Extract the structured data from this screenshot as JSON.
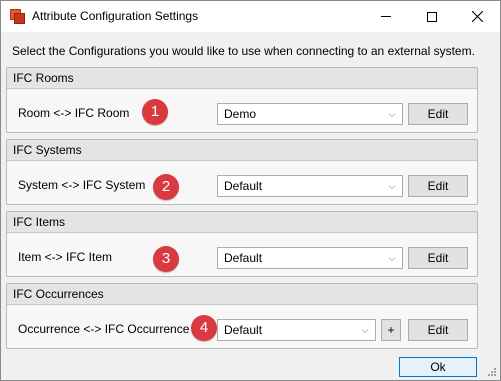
{
  "window": {
    "title": "Attribute Configuration Settings",
    "accent_color": "#d93a3f",
    "app_icon": "app-logo-icon"
  },
  "instruction": "Select the Configurations you would like to use when connecting to an external system.",
  "groups": [
    {
      "header": "IFC Rooms",
      "label": "Room <-> IFC Room",
      "badge": "1",
      "selected": "Demo",
      "edit_label": "Edit"
    },
    {
      "header": "IFC Systems",
      "label": "System <-> IFC System",
      "badge": "2",
      "selected": "Default",
      "edit_label": "Edit"
    },
    {
      "header": "IFC Items",
      "label": "Item <-> IFC Item",
      "badge": "3",
      "selected": "Default",
      "edit_label": "Edit"
    },
    {
      "header": "IFC Occurrences",
      "label": "Occurrence <-> IFC Occurrence",
      "badge": "4",
      "selected": "Default",
      "edit_label": "Edit",
      "plus_label": "+"
    }
  ],
  "footer": {
    "ok_label": "Ok"
  }
}
